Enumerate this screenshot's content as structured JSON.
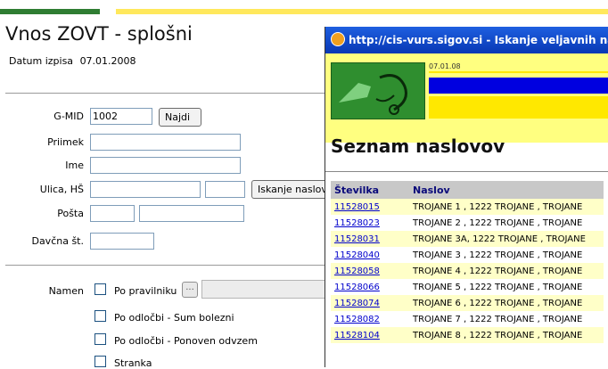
{
  "form": {
    "title": "Vnos ZOVT - splošni",
    "date_label": "Datum izpisa",
    "date_value": "07.01.2008",
    "gmid_label": "G-MID",
    "gmid_value": "1002",
    "find_button": "Najdi",
    "surname_label": "Priimek",
    "name_label": "Ime",
    "street_label": "Ulica, HŠ",
    "search_address_button": "Iskanje naslov",
    "post_label": "Pošta",
    "tax_label": "Davčna št.",
    "purpose_label": "Namen",
    "checkboxes": [
      {
        "label": "Po pravilniku",
        "checked": false
      },
      {
        "label": "Po odločbi - Sum bolezni",
        "checked": false
      },
      {
        "label": "Po odločbi - Ponoven odvzem",
        "checked": false
      },
      {
        "label": "Stranka",
        "checked": false
      }
    ],
    "ellipsis_button": "..."
  },
  "popup": {
    "title": "http://cis-vurs.sigov.si - Iskanje veljavnih na",
    "header_date": "07.01.08",
    "heading": "Seznam naslovov",
    "columns": [
      "Številka",
      "Naslov"
    ],
    "rows": [
      {
        "num": "11528015",
        "addr": "TROJANE 1 , 1222 TROJANE , TROJANE"
      },
      {
        "num": "11528023",
        "addr": "TROJANE 2 , 1222 TROJANE , TROJANE"
      },
      {
        "num": "11528031",
        "addr": "TROJANE 3A, 1222 TROJANE , TROJANE"
      },
      {
        "num": "11528040",
        "addr": "TROJANE 3 , 1222 TROJANE , TROJANE"
      },
      {
        "num": "11528058",
        "addr": "TROJANE 4 , 1222 TROJANE , TROJANE"
      },
      {
        "num": "11528066",
        "addr": "TROJANE 5 , 1222 TROJANE , TROJANE"
      },
      {
        "num": "11528074",
        "addr": "TROJANE 6 , 1222 TROJANE , TROJANE"
      },
      {
        "num": "11528082",
        "addr": "TROJANE 7 , 1222 TROJANE , TROJANE"
      },
      {
        "num": "11528104",
        "addr": "TROJANE 8 , 1222 TROJANE , TROJANE"
      }
    ]
  },
  "colors": {
    "popup_title_bg": "#0838b4",
    "popup_header_bg": "#ffff80",
    "row_alt": "#ffffc8",
    "link": "#0000cc"
  }
}
